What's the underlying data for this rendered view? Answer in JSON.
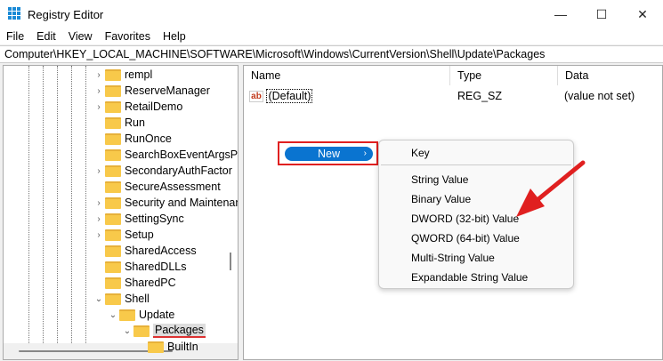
{
  "window": {
    "title": "Registry Editor",
    "minimize": "—",
    "maximize": "☐",
    "close": "✕"
  },
  "menu": [
    "File",
    "Edit",
    "View",
    "Favorites",
    "Help"
  ],
  "address": "Computer\\HKEY_LOCAL_MACHINE\\SOFTWARE\\Microsoft\\Windows\\CurrentVersion\\Shell\\Update\\Packages",
  "tree": [
    {
      "label": "rempl",
      "level": 0,
      "state": "collapsed"
    },
    {
      "label": "ReserveManager",
      "level": 0,
      "state": "collapsed"
    },
    {
      "label": "RetailDemo",
      "level": 0,
      "state": "collapsed"
    },
    {
      "label": "Run",
      "level": 0,
      "state": "none"
    },
    {
      "label": "RunOnce",
      "level": 0,
      "state": "none"
    },
    {
      "label": "SearchBoxEventArgsProvider",
      "level": 0,
      "state": "none"
    },
    {
      "label": "SecondaryAuthFactor",
      "level": 0,
      "state": "collapsed"
    },
    {
      "label": "SecureAssessment",
      "level": 0,
      "state": "none"
    },
    {
      "label": "Security and Maintenance",
      "level": 0,
      "state": "collapsed"
    },
    {
      "label": "SettingSync",
      "level": 0,
      "state": "collapsed"
    },
    {
      "label": "Setup",
      "level": 0,
      "state": "collapsed"
    },
    {
      "label": "SharedAccess",
      "level": 0,
      "state": "none"
    },
    {
      "label": "SharedDLLs",
      "level": 0,
      "state": "none"
    },
    {
      "label": "SharedPC",
      "level": 0,
      "state": "none"
    },
    {
      "label": "Shell",
      "level": 0,
      "state": "expanded"
    },
    {
      "label": "Update",
      "level": 1,
      "state": "expanded"
    },
    {
      "label": "Packages",
      "level": 2,
      "state": "expanded",
      "selected": true
    },
    {
      "label": "BuiltIn",
      "level": 3,
      "state": "none"
    }
  ],
  "columns": [
    "Name",
    "Type",
    "Data"
  ],
  "values": [
    {
      "name": "(Default)",
      "type": "REG_SZ",
      "data": "(value not set)"
    }
  ],
  "context_menu": {
    "new_label": "New"
  },
  "submenu": [
    "Key",
    "String Value",
    "Binary Value",
    "DWORD (32-bit) Value",
    "QWORD (64-bit) Value",
    "Multi-String Value",
    "Expandable String Value"
  ],
  "colors": {
    "accent": "#0a74d0",
    "highlight": "#e02020"
  }
}
